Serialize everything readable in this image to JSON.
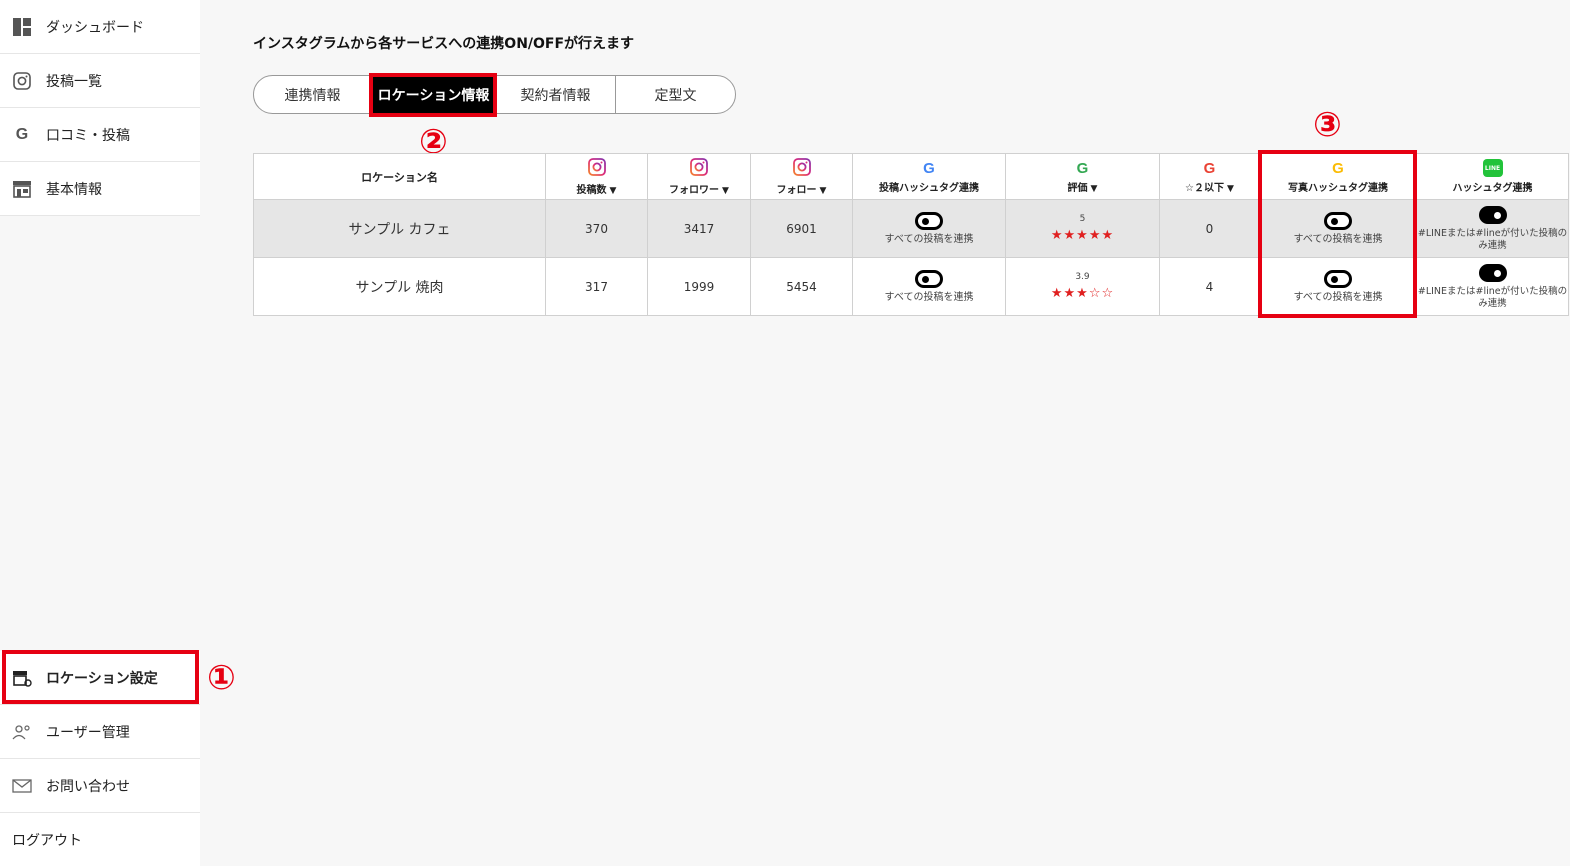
{
  "sidebar": {
    "items": [
      {
        "label": "ダッシュボード",
        "icon": "dashboard-icon"
      },
      {
        "label": "投稿一覧",
        "icon": "instagram-icon"
      },
      {
        "label": "口コミ・投稿",
        "icon": "google-icon"
      },
      {
        "label": "基本情報",
        "icon": "store-icon"
      },
      {
        "label": "ロケーション設定",
        "icon": "location-settings-icon"
      },
      {
        "label": "ユーザー管理",
        "icon": "users-icon"
      },
      {
        "label": "お問い合わせ",
        "icon": "mail-icon"
      },
      {
        "label": "ログアウト"
      }
    ]
  },
  "main": {
    "intro": "インスタグラムから各サービスへの連携ON/OFFが行えます",
    "tabs": [
      {
        "label": "連携情報"
      },
      {
        "label": "ロケーション情報"
      },
      {
        "label": "契約者情報"
      },
      {
        "label": "定型文"
      }
    ],
    "active_tab": "ロケーション情報"
  },
  "markers": [
    "①",
    "②",
    "③"
  ],
  "table": {
    "headers": [
      {
        "label": "ロケーション名"
      },
      {
        "label": "投稿数",
        "icon": "instagram-icon",
        "sort": "▼"
      },
      {
        "label": "フォロワー",
        "icon": "instagram-icon",
        "sort": "▼"
      },
      {
        "label": "フォロー",
        "icon": "instagram-icon",
        "sort": "▼"
      },
      {
        "label": "投稿ハッシュタグ連携",
        "icon": "google-icon"
      },
      {
        "label": "評価",
        "icon": "google-icon",
        "sort": "▼"
      },
      {
        "label": "☆２以下",
        "icon": "google-icon",
        "sort": "▼"
      },
      {
        "label": "写真ハッシュタグ連携",
        "icon": "google-icon"
      },
      {
        "label": "ハッシュタグ連携",
        "icon": "line-icon"
      }
    ],
    "line_icon_text": "LINE",
    "rows": [
      {
        "name": "サンプル カフェ",
        "posts": "370",
        "followers": "3417",
        "following": "6901",
        "post_hashtag_label": "すべての投稿を連携",
        "rating": "5",
        "stars": "★★★★★",
        "low_reviews": "0",
        "photo_hashtag_label": "すべての投稿を連携",
        "line_label": "#LINEまたは#lineが付いた投稿のみ連携"
      },
      {
        "name": "サンプル 焼肉",
        "posts": "317",
        "followers": "1999",
        "following": "5454",
        "post_hashtag_label": "すべての投稿を連携",
        "rating": "3.9",
        "stars": "★★★☆☆",
        "low_reviews": "4",
        "photo_hashtag_label": "すべての投稿を連携",
        "line_label": "#LINEまたは#lineが付いた投稿のみ連携"
      }
    ]
  },
  "colors": {
    "accent": "#e60012",
    "star": "#e02020",
    "line": "#22c33a"
  }
}
